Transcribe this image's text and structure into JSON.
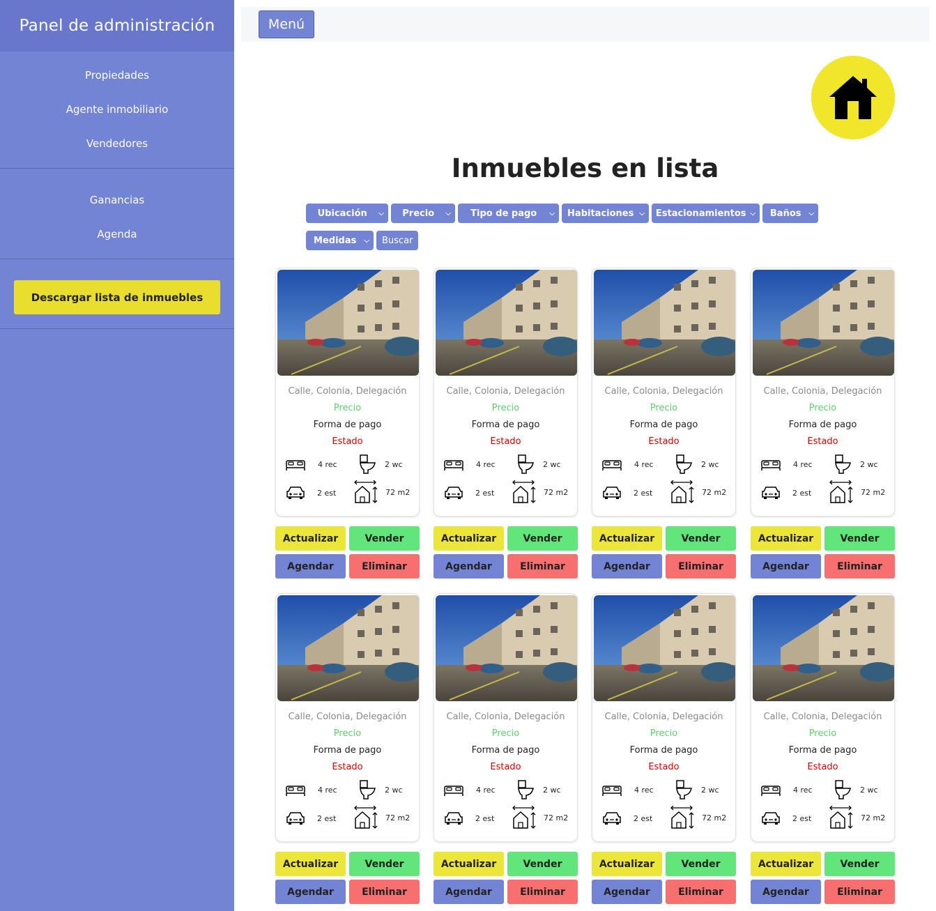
{
  "sidebar": {
    "title": "Panel de administración",
    "group1": [
      "Propiedades",
      "Agente inmobiliario",
      "Vendedores"
    ],
    "group2": [
      "Ganancias",
      "Agenda"
    ],
    "download_label": "Descargar lista de inmuebles"
  },
  "topbar": {
    "menu_label": "Menú"
  },
  "main": {
    "title": "Inmuebles en lista",
    "filters_row1": [
      "Ubicación",
      "Precio",
      "Tipo de pago",
      "Habitaciones",
      "Estacionamientos",
      "Baños"
    ],
    "filters_row2": [
      "Medidas"
    ],
    "search_label": "Buscar"
  },
  "colors": {
    "sidebar": "#7484d4",
    "accent_yellow": "#ede63a",
    "accent_green": "#62e57a",
    "accent_red": "#f86f6f",
    "price_green": "#5fd26b",
    "state_red": "#dd0000"
  },
  "cards": [
    {
      "address": "Calle, Colonia, Delegación",
      "price": "Precio",
      "payment": "Forma de pago",
      "state": "Estado",
      "rooms": "4 rec",
      "baths": "2 wc",
      "parking": "2 est",
      "size": "72 m2"
    },
    {
      "address": "Calle, Colonia, Delegación",
      "price": "Precio",
      "payment": "Forma de pago",
      "state": "Estado",
      "rooms": "4 rec",
      "baths": "2 wc",
      "parking": "2 est",
      "size": "72 m2"
    },
    {
      "address": "Calle, Colonia, Delegación",
      "price": "Precio",
      "payment": "Forma de pago",
      "state": "Estado",
      "rooms": "4 rec",
      "baths": "2 wc",
      "parking": "2 est",
      "size": "72 m2"
    },
    {
      "address": "Calle, Colonia, Delegación",
      "price": "Precio",
      "payment": "Forma de pago",
      "state": "Estado",
      "rooms": "4 rec",
      "baths": "2 wc",
      "parking": "2 est",
      "size": "72 m2"
    },
    {
      "address": "Calle, Colonia, Delegación",
      "price": "Precio",
      "payment": "Forma de pago",
      "state": "Estado",
      "rooms": "4 rec",
      "baths": "2 wc",
      "parking": "2 est",
      "size": "72 m2"
    },
    {
      "address": "Calle, Colonia, Delegación",
      "price": "Precio",
      "payment": "Forma de pago",
      "state": "Estado",
      "rooms": "4 rec",
      "baths": "2 wc",
      "parking": "2 est",
      "size": "72 m2"
    },
    {
      "address": "Calle, Colonia, Delegación",
      "price": "Precio",
      "payment": "Forma de pago",
      "state": "Estado",
      "rooms": "4 rec",
      "baths": "2 wc",
      "parking": "2 est",
      "size": "72 m2"
    },
    {
      "address": "Calle, Colonia, Delegación",
      "price": "Precio",
      "payment": "Forma de pago",
      "state": "Estado",
      "rooms": "4 rec",
      "baths": "2 wc",
      "parking": "2 est",
      "size": "72 m2"
    }
  ],
  "card_actions": {
    "update": "Actualizar",
    "sell": "Vender",
    "schedule": "Agendar",
    "delete": "Eliminar"
  }
}
